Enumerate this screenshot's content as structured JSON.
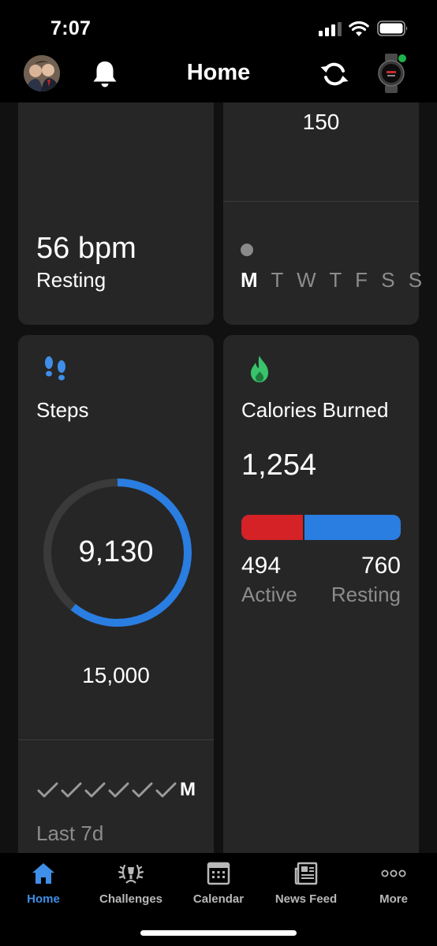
{
  "status_bar": {
    "time": "7:07",
    "icons": [
      "cellular-signal-icon",
      "wifi-icon",
      "battery-icon"
    ]
  },
  "header": {
    "title": "Home",
    "icons": [
      "avatar",
      "bell-icon",
      "sync-icon",
      "watch-icon"
    ],
    "device_connected_color": "#1fb24a"
  },
  "cards": {
    "heart_rate": {
      "value": "56 bpm",
      "label": "Resting"
    },
    "sleep": {
      "value": "150",
      "days": [
        "M",
        "T",
        "W",
        "T",
        "F",
        "S",
        "S"
      ],
      "today_index": 0
    },
    "steps": {
      "title": "Steps",
      "icon": "footsteps-icon",
      "value": "9,130",
      "goal": "15,000",
      "progress": 0.6087,
      "week_checks": 6,
      "week_day": "M",
      "period_label": "Last 7d",
      "ring_color": "#2a7de1"
    },
    "calories": {
      "title": "Calories Burned",
      "icon": "flame-icon",
      "total": "1,254",
      "active": "494",
      "resting": "760",
      "active_label": "Active",
      "resting_label": "Resting",
      "active_fraction": 0.394,
      "active_color": "#d42226",
      "resting_color": "#2a7de1"
    }
  },
  "tabs": [
    {
      "label": "Home",
      "icon": "home-icon",
      "active": true
    },
    {
      "label": "Challenges",
      "icon": "laurel-icon",
      "active": false
    },
    {
      "label": "Calendar",
      "icon": "calendar-icon",
      "active": false
    },
    {
      "label": "News Feed",
      "icon": "newspaper-icon",
      "active": false
    },
    {
      "label": "More",
      "icon": "more-icon",
      "active": false
    }
  ],
  "colors": {
    "accent": "#3f8ee8",
    "card": "#262626",
    "background": "#111111"
  }
}
